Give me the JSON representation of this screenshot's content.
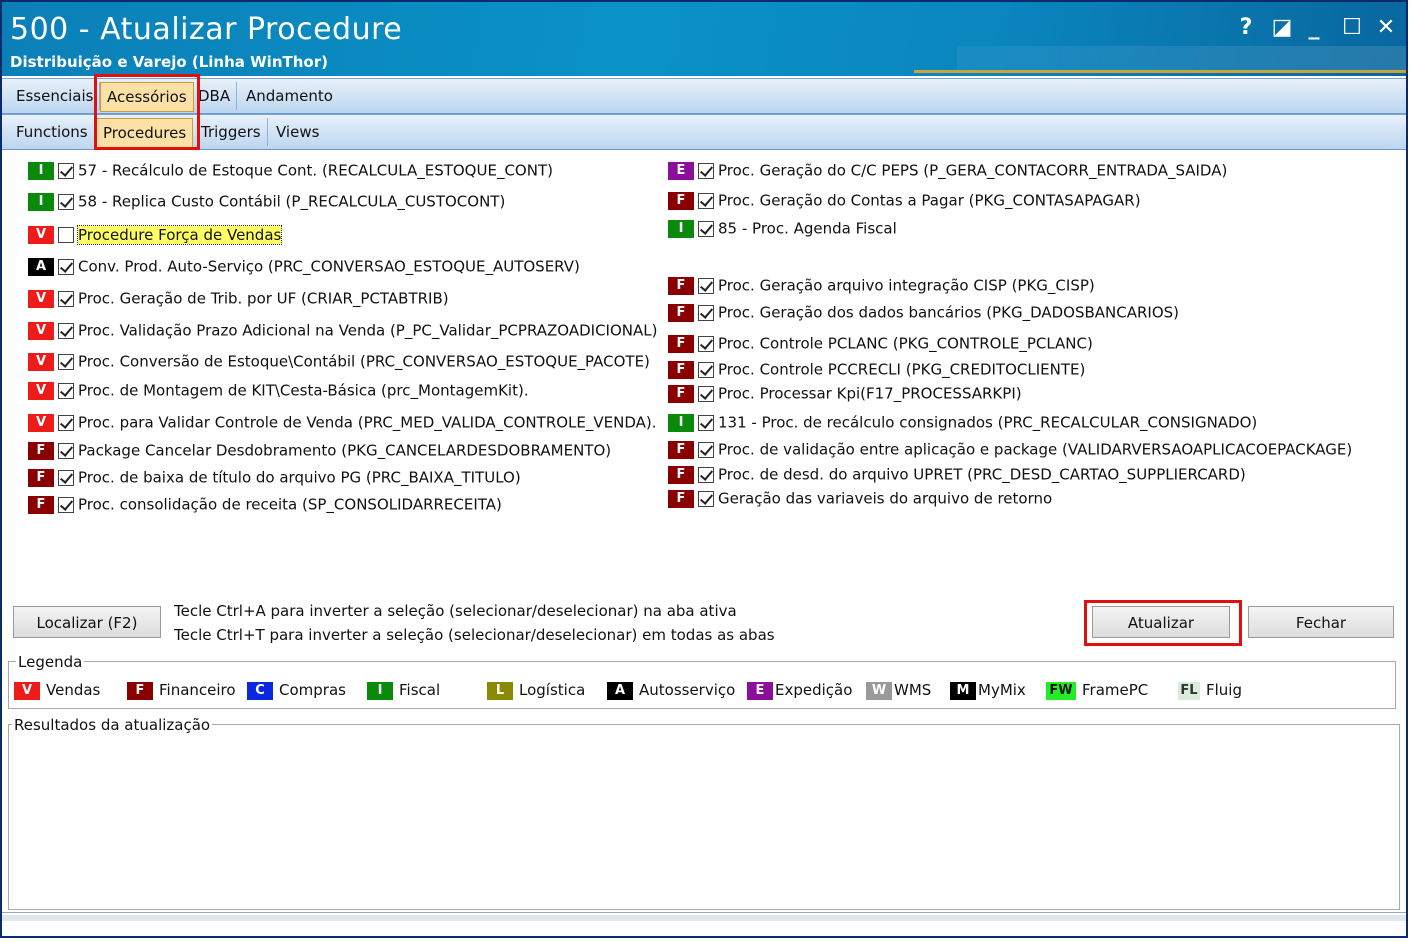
{
  "window": {
    "title": "500 - Atualizar Procedure",
    "subtitle": "Distribuição e Varejo (Linha WinThor)",
    "buttons": {
      "help": "?",
      "restore": "◪",
      "minimize": "_",
      "maximize": "☐",
      "close": "✕"
    }
  },
  "tabs_main": [
    {
      "label": "Essenciais",
      "active": false
    },
    {
      "label": "Acessórios",
      "active": true
    },
    {
      "label": "DBA",
      "active": false
    },
    {
      "label": "Andamento",
      "active": false
    }
  ],
  "tabs_sub": [
    {
      "label": "Functions",
      "active": false
    },
    {
      "label": "Procedures",
      "active": true
    },
    {
      "label": "Triggers",
      "active": false
    },
    {
      "label": "Views",
      "active": false
    }
  ],
  "left_items": [
    {
      "badge": "I",
      "checked": true,
      "label": "57 - Recálculo de Estoque Cont. (RECALCULA_ESTOQUE_CONT)"
    },
    {
      "badge": "I",
      "checked": true,
      "label": "58 - Replica Custo Contábil (P_RECALCULA_CUSTOCONT)"
    },
    {
      "badge": "V",
      "checked": false,
      "label": "Procedure Força de Vendas",
      "highlight": true
    },
    {
      "badge": "A",
      "checked": true,
      "label": "Conv. Prod. Auto-Serviço (PRC_CONVERSAO_ESTOQUE_AUTOSERV)"
    },
    {
      "badge": "V",
      "checked": true,
      "label": "Proc. Geração de Trib. por UF (CRIAR_PCTABTRIB)"
    },
    {
      "badge": "V",
      "checked": true,
      "label": "Proc. Validação Prazo Adicional na Venda (P_PC_Validar_PCPRAZOADICIONAL)"
    },
    {
      "badge": "V",
      "checked": true,
      "label": "Proc. Conversão de Estoque\\Contábil (PRC_CONVERSAO_ESTOQUE_PACOTE)"
    },
    {
      "badge": "V",
      "checked": true,
      "label": "Proc. de Montagem de KIT\\Cesta-Básica (prc_MontagemKit)."
    },
    {
      "badge": "V",
      "checked": true,
      "label": "Proc. para Validar Controle de Venda (PRC_MED_VALIDA_CONTROLE_VENDA)."
    },
    {
      "badge": "F",
      "checked": true,
      "label": "Package Cancelar Desdobramento (PKG_CANCELARDESDOBRAMENTO)"
    },
    {
      "badge": "F",
      "checked": true,
      "label": "Proc. de baixa de título do arquivo PG (PRC_BAIXA_TITULO)"
    },
    {
      "badge": "F",
      "checked": true,
      "label": "Proc. consolidação de receita (SP_CONSOLIDARRECEITA)"
    }
  ],
  "right_items": [
    {
      "badge": "E",
      "checked": true,
      "label": "Proc. Geração do C/C PEPS (P_GERA_CONTACORR_ENTRADA_SAIDA)"
    },
    {
      "badge": "F",
      "checked": true,
      "label": "Proc. Geração do Contas a Pagar (PKG_CONTASAPAGAR)"
    },
    {
      "badge": "I",
      "checked": true,
      "label": "85 - Proc. Agenda Fiscal"
    },
    {
      "badge": "F",
      "checked": true,
      "label": "Proc. Geração arquivo integração CISP (PKG_CISP)"
    },
    {
      "badge": "F",
      "checked": true,
      "label": "Proc. Geração dos dados bancários (PKG_DADOSBANCARIOS)"
    },
    {
      "badge": "F",
      "checked": true,
      "label": "Proc. Controle PCLANC (PKG_CONTROLE_PCLANC)"
    },
    {
      "badge": "F",
      "checked": true,
      "label": "Proc. Controle PCCRECLI (PKG_CREDITOCLIENTE)"
    },
    {
      "badge": "F",
      "checked": true,
      "label": "Proc. Processar Kpi(F17_PROCESSARKPI)"
    },
    {
      "badge": "I",
      "checked": true,
      "label": "131 - Proc. de recálculo consignados (PRC_RECALCULAR_CONSIGNADO)"
    },
    {
      "badge": "F",
      "checked": true,
      "label": "Proc. de validação entre aplicação e package (VALIDARVERSAOAPLICACOEPACKAGE)"
    },
    {
      "badge": "F",
      "checked": true,
      "label": "Proc. de desd. do arquivo UPRET (PRC_DESD_CARTAO_SUPPLIERCARD)"
    },
    {
      "badge": "F",
      "checked": true,
      "label": "Geração das variaveis do arquivo de retorno"
    }
  ],
  "actions": {
    "localizar": "Localizar (F2)",
    "hint1": "Tecle Ctrl+A para inverter a seleção (selecionar/deselecionar) na aba ativa",
    "hint2": "Tecle Ctrl+T para inverter a seleção (selecionar/deselecionar) em todas as abas",
    "atualizar": "Atualizar",
    "fechar": "Fechar"
  },
  "legend": {
    "title": "Legenda",
    "items": [
      {
        "badge": "V",
        "label": "Vendas"
      },
      {
        "badge": "F",
        "label": "Financeiro"
      },
      {
        "badge": "C",
        "label": "Compras"
      },
      {
        "badge": "I",
        "label": "Fiscal"
      },
      {
        "badge": "L",
        "label": "Logística"
      },
      {
        "badge": "A",
        "label": "Autosserviço"
      },
      {
        "badge": "E",
        "label": "Expedição"
      },
      {
        "badge": "W",
        "label": "WMS"
      },
      {
        "badge": "M",
        "label": "MyMix"
      },
      {
        "badge": "FW",
        "label": "FramePC"
      },
      {
        "badge": "FL",
        "label": "Fluig"
      }
    ]
  },
  "results": {
    "title": "Resultados da atualização"
  },
  "colors": {
    "highlight_box": "#e01010",
    "title_bar": "#0a92c6"
  }
}
